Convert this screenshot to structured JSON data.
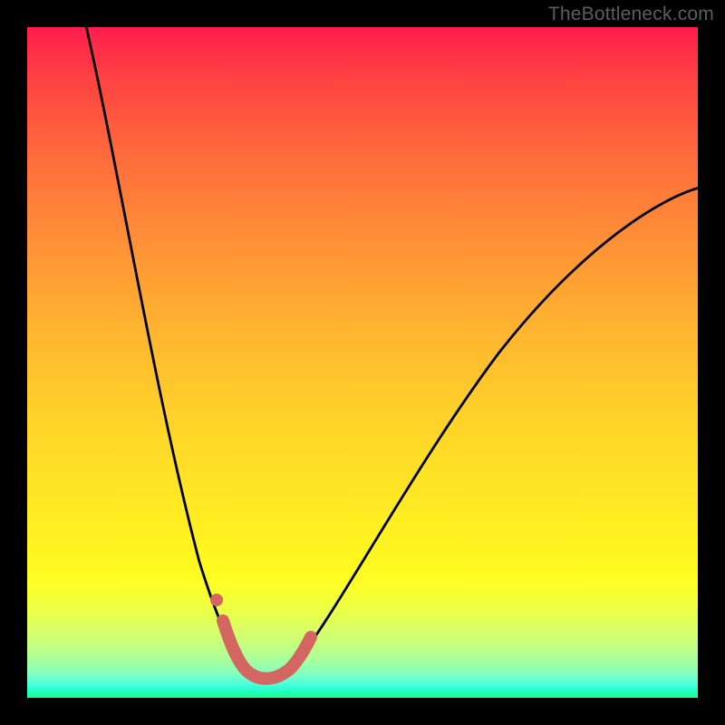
{
  "watermark": "TheBottleneck.com",
  "colors": {
    "frame_bg": "#000000",
    "watermark_text": "#5d5d5d",
    "curve_stroke": "#000000",
    "highlight_stroke": "#d36661",
    "gradient_top": "#ff1d4d",
    "gradient_bottom": "#1cff88"
  },
  "chart_data": {
    "type": "line",
    "title": "",
    "xlabel": "",
    "ylabel": "",
    "xlim": [
      0,
      100
    ],
    "ylim": [
      0,
      100
    ],
    "grid": false,
    "legend": false,
    "background": "vertical red→yellow→green gradient",
    "series": [
      {
        "name": "bottleneck-curve",
        "color": "#000000",
        "x": [
          9,
          15,
          20,
          25,
          28,
          30,
          33,
          35,
          38,
          42,
          48,
          55,
          65,
          75,
          85,
          95,
          100
        ],
        "values": [
          101,
          75,
          55,
          35,
          22,
          12,
          4,
          3,
          4,
          8,
          18,
          30,
          45,
          58,
          68,
          74,
          77
        ]
      },
      {
        "name": "highlight-segment",
        "color": "#d36661",
        "x": [
          29,
          31,
          33,
          35,
          38,
          40,
          42
        ],
        "values": [
          11,
          6,
          4,
          3,
          4,
          6,
          9
        ]
      }
    ],
    "annotations": [
      {
        "name": "highlight-dot",
        "x": 28,
        "y": 14,
        "color": "#d36661"
      }
    ]
  }
}
